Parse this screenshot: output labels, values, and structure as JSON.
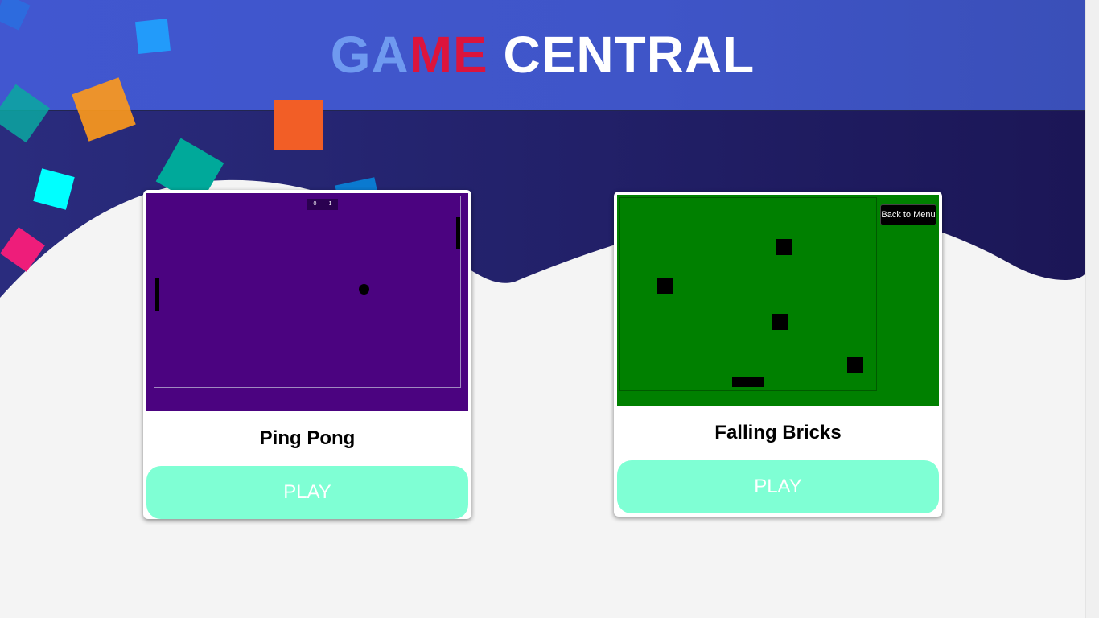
{
  "header": {
    "title_part1": "GA",
    "title_part2": "ME",
    "title_part3": "CENTRAL"
  },
  "games": [
    {
      "name": "Ping Pong",
      "play_label": "PLAY",
      "preview": {
        "score_left": "0",
        "score_right": "1"
      }
    },
    {
      "name": "Falling Bricks",
      "play_label": "PLAY",
      "preview": {
        "back_label": "Back to Menu"
      }
    }
  ],
  "colors": {
    "header_bg": "#4157d0",
    "wave_dark": "#22206a",
    "title_ga": "#6f9af0",
    "title_me": "#dc143c",
    "pong_bg": "#4b0380",
    "bricks_bg": "#008000",
    "play_button": "#7fffd4"
  }
}
